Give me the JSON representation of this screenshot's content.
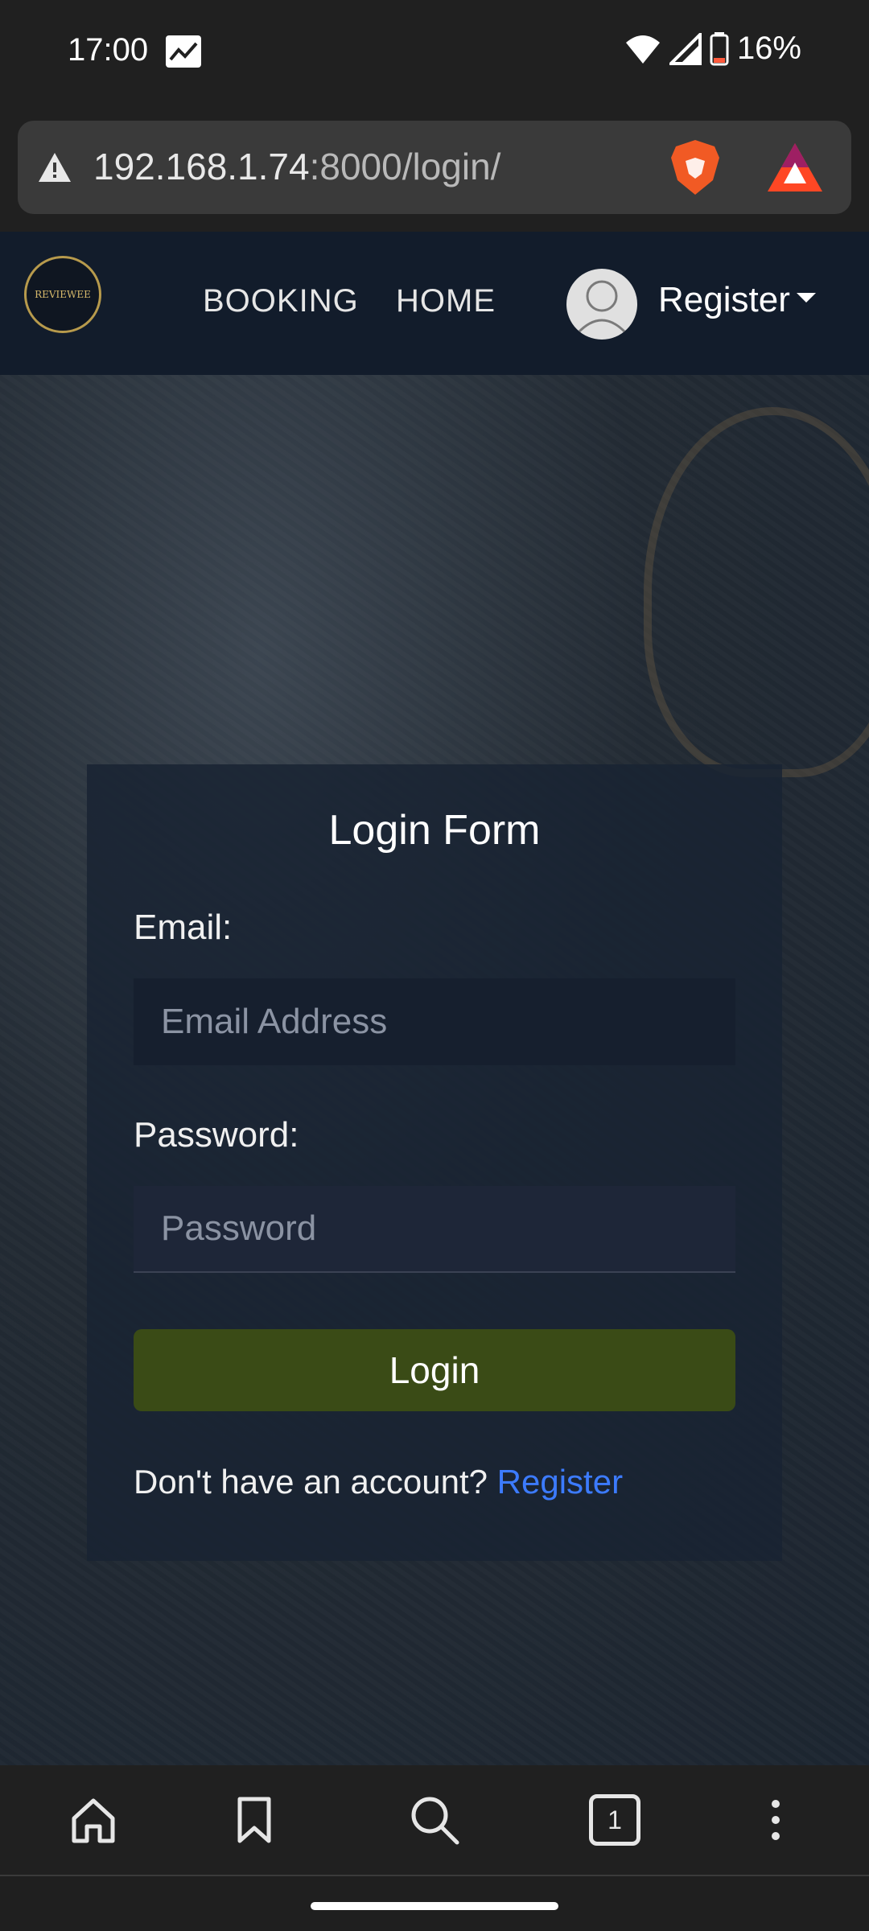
{
  "status_bar": {
    "time": "17:00",
    "battery": "16%",
    "icons": [
      "image-notification-icon",
      "wifi-icon",
      "signal-icon",
      "battery-icon"
    ]
  },
  "browser": {
    "url_host": "192.168.1.74",
    "url_rest": ":8000/login/",
    "icons": [
      "warning-icon",
      "brave-lion-icon",
      "bat-rewards-icon"
    ]
  },
  "site_header": {
    "logo_text": "REVIEWEE",
    "nav": {
      "booking": "BOOKING",
      "home": "HOME"
    },
    "user_menu": "Register"
  },
  "login_form": {
    "title": "Login Form",
    "email_label": "Email:",
    "email_placeholder": "Email Address",
    "password_label": "Password:",
    "password_placeholder": "Password",
    "submit": "Login",
    "signup_prompt": "Don't have an account?",
    "signup_link": "Register"
  },
  "bottom_nav": {
    "icons": [
      "home-icon",
      "bookmark-icon",
      "search-icon",
      "tabs-icon",
      "more-icon"
    ],
    "tab_count": "1"
  },
  "colors": {
    "header_bg": "#121c2b",
    "button_bg": "#3a4b16",
    "link": "#3c7bff"
  }
}
